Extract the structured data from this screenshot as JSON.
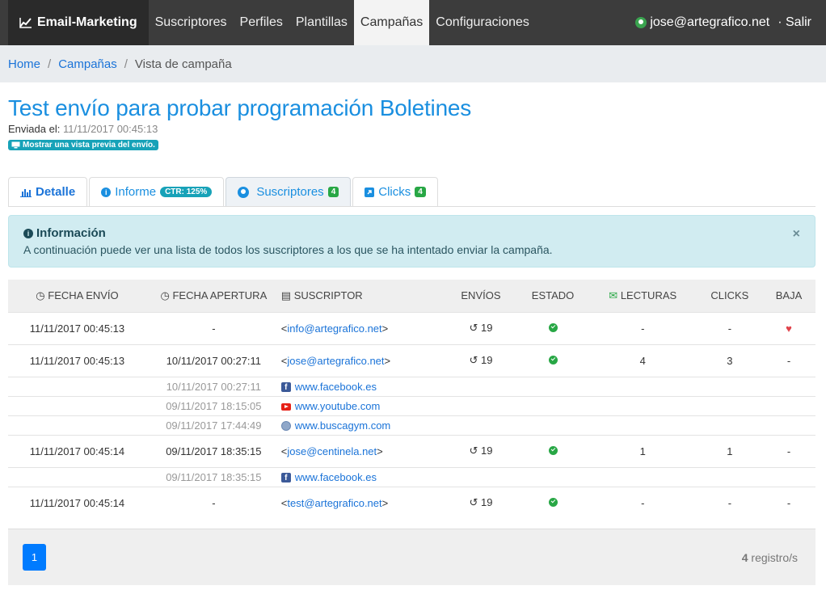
{
  "nav": {
    "brand": "Email-Marketing",
    "items": [
      "Suscriptores",
      "Perfiles",
      "Plantillas",
      "Campañas",
      "Configuraciones"
    ],
    "active": "Campañas",
    "user": "jose@artegrafico.net",
    "logout": "· Salir"
  },
  "breadcrumb": {
    "home": "Home",
    "campaigns": "Campañas",
    "current": "Vista de campaña"
  },
  "campaign": {
    "title": "Test envío para probar programación Boletines",
    "sent_label": "Enviada el:",
    "sent_value": "11/11/2017 00:45:13",
    "preview_label": "Mostrar una vista previa del envío."
  },
  "tabs": {
    "detalle": "Detalle",
    "informe": "Informe",
    "informe_badge": "CTR: 125%",
    "suscriptores": "Suscriptores",
    "suscriptores_badge": "4",
    "clicks": "Clicks",
    "clicks_badge": "4"
  },
  "alert": {
    "title": "Información",
    "body": "A continuación puede ver una lista de todos los suscriptores a los que se ha intentado enviar la campaña.",
    "close": "×"
  },
  "table": {
    "headers": {
      "fecha_envio": "FECHA ENVÍO",
      "fecha_apertura": "FECHA APERTURA",
      "suscriptor": "SUSCRIPTOR",
      "envios": "ENVÍOS",
      "estado": "ESTADO",
      "lecturas": "LECTURAS",
      "clicks": "CLICKS",
      "baja": "BAJA"
    },
    "rows": [
      {
        "envio": "11/11/2017 00:45:13",
        "apertura": "-",
        "email": "info@artegrafico.net",
        "envios": "19",
        "lecturas": "-",
        "clicks": "-",
        "baja": "heart"
      },
      {
        "envio": "11/11/2017 00:45:13",
        "apertura": "10/11/2017 00:27:11",
        "email": "jose@artegrafico.net",
        "envios": "19",
        "lecturas": "4",
        "clicks": "3",
        "baja": "-"
      },
      {
        "envio": "11/11/2017 00:45:14",
        "apertura": "09/11/2017 18:35:15",
        "email": "jose@centinela.net",
        "envios": "19",
        "lecturas": "1",
        "clicks": "1",
        "baja": "-"
      },
      {
        "envio": "11/11/2017 00:45:14",
        "apertura": "-",
        "email": "test@artegrafico.net",
        "envios": "19",
        "lecturas": "-",
        "clicks": "-",
        "baja": "-"
      }
    ],
    "sub_rows": [
      {
        "date": "10/11/2017 00:27:11",
        "site": "www.facebook.es",
        "icon": "facebook-icon"
      },
      {
        "date": "09/11/2017 18:15:05",
        "site": "www.youtube.com",
        "icon": "youtube-icon"
      },
      {
        "date": "09/11/2017 17:44:49",
        "site": "www.buscagym.com",
        "icon": "globe-icon"
      },
      {
        "date": "09/11/2017 18:35:15",
        "site": "www.facebook.es",
        "icon": "facebook-icon"
      }
    ]
  },
  "pagination": {
    "page": "1",
    "count": "4",
    "records_suffix": "registro/s"
  },
  "icons": {
    "lt": "<",
    "gt": ">"
  }
}
